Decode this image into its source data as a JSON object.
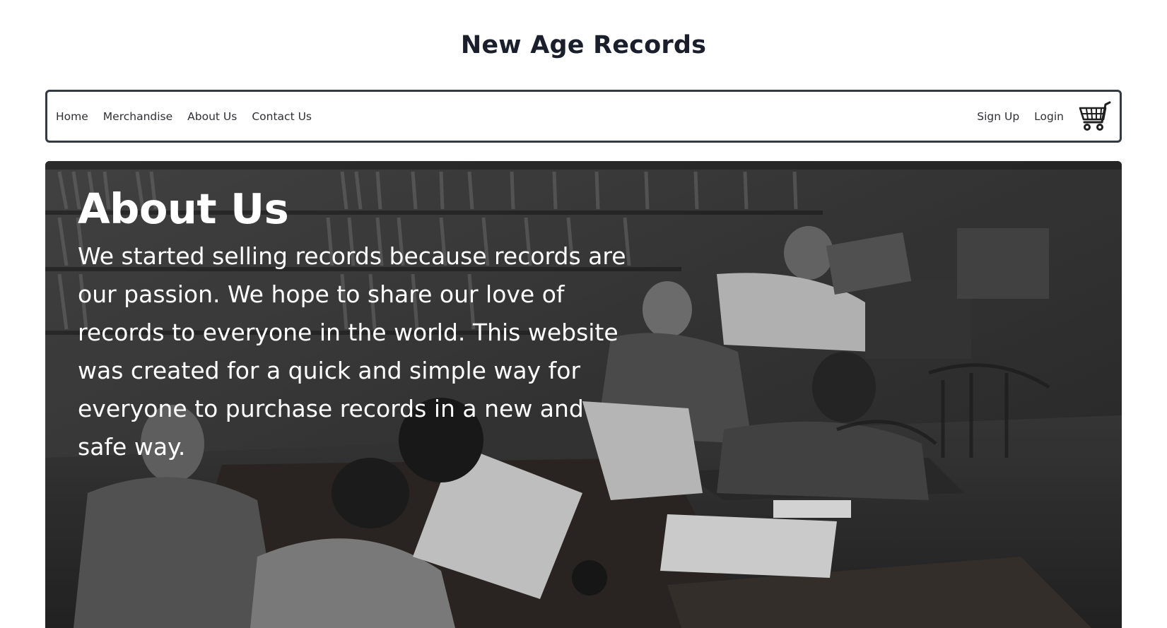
{
  "header": {
    "title": "New Age Records"
  },
  "nav": {
    "left": [
      {
        "label": "Home"
      },
      {
        "label": "Merchandise"
      },
      {
        "label": "About Us"
      },
      {
        "label": "Contact Us"
      }
    ],
    "right": [
      {
        "label": "Sign Up"
      },
      {
        "label": "Login"
      }
    ],
    "cart_icon": "shopping-cart-icon"
  },
  "hero": {
    "heading": "About Us",
    "body": "We started selling records because records are our passion. We hope to share our love of records to everyone in the world. This website was created for a quick and simple way for everyone to purchase records in a new and safe way.",
    "photo": "black-and-white photo of people listening to records with headphones at tables in a record library"
  },
  "colors": {
    "nav_border": "#343a40",
    "title": "#1b1f2b",
    "hero_text": "#ffffff"
  }
}
